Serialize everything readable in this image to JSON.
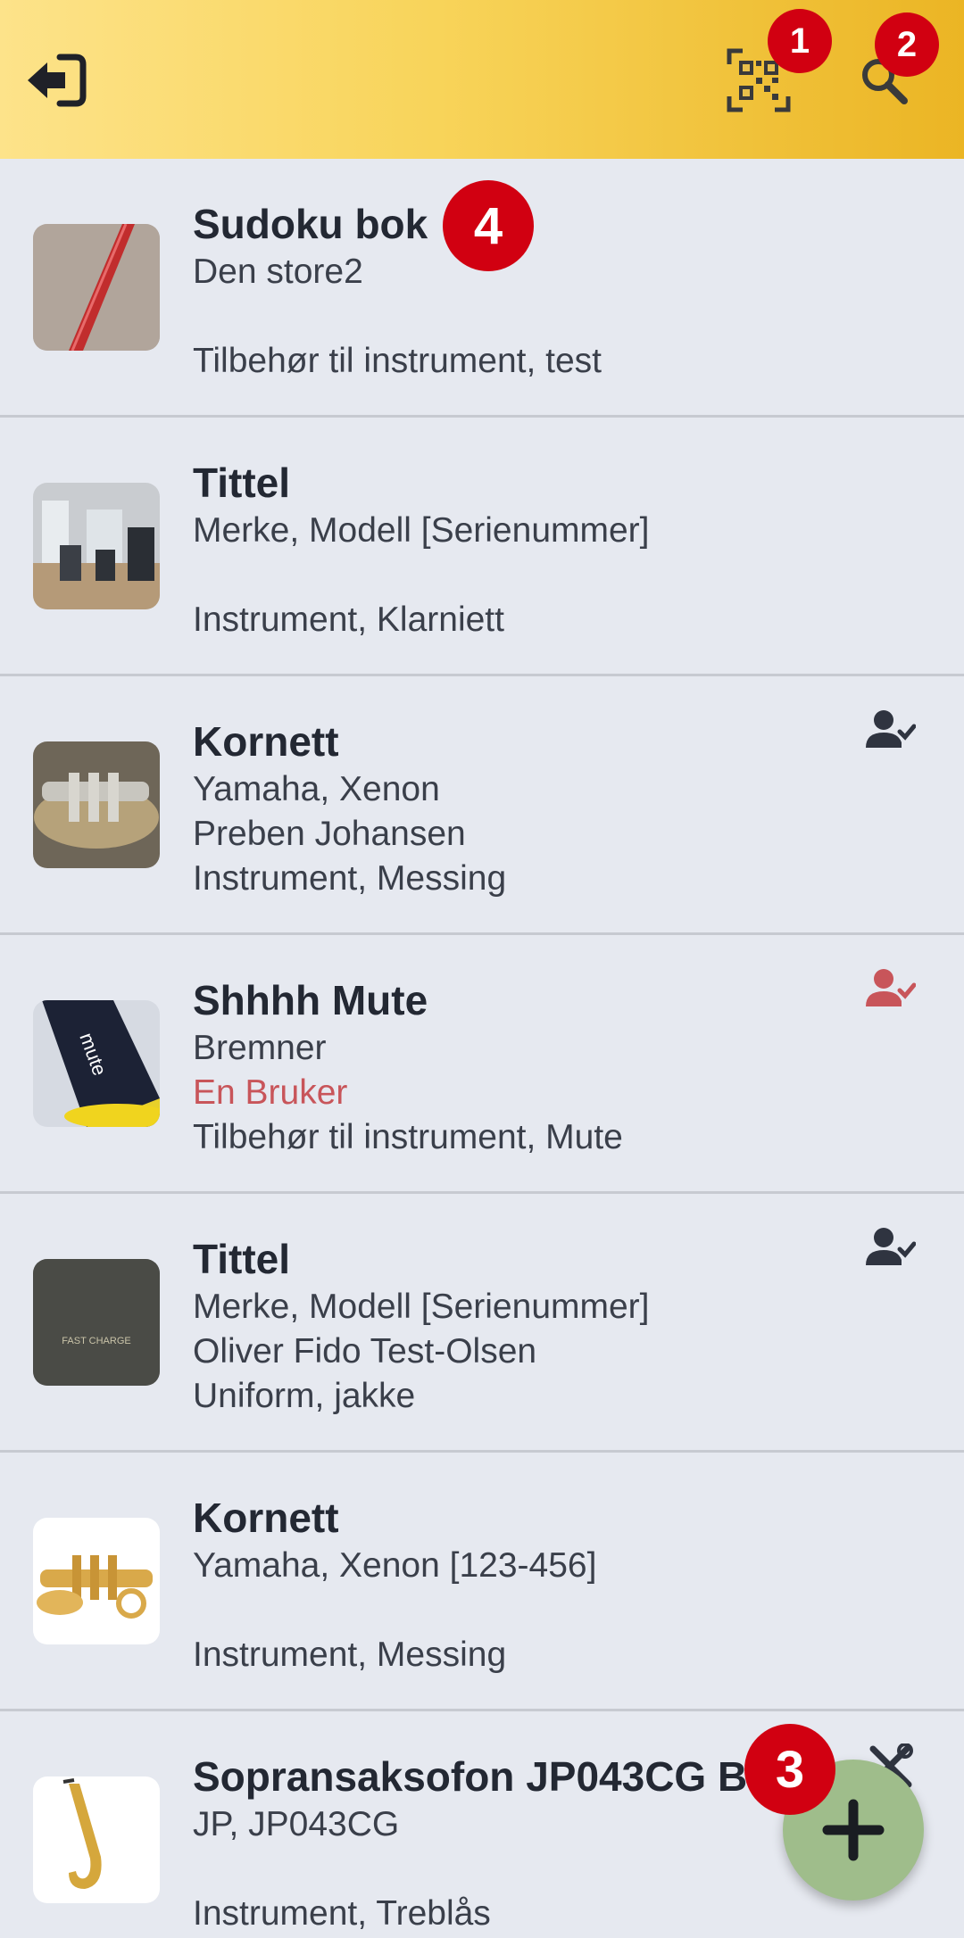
{
  "appbar": {
    "back_icon": "logout-arrow-icon",
    "qr_icon": "qr-code-scan-icon",
    "search_icon": "search-icon",
    "background_gradient": [
      "#fde38a",
      "#ebb524"
    ]
  },
  "badges": {
    "qr": "1",
    "search": "2",
    "fab": "3",
    "first_item": "4",
    "color": "#d10011"
  },
  "items": [
    {
      "title": "Sudoku bok",
      "line1": "Den store2",
      "line2": "",
      "line3": "Tilbehør til instrument, test",
      "status_icon": ""
    },
    {
      "title": "Tittel",
      "line1": "Merke, Modell [Serienummer]",
      "line2": "",
      "line3": "Instrument, Klarniett",
      "status_icon": ""
    },
    {
      "title": "Kornett",
      "line1": "Yamaha, Xenon",
      "line2": "Preben Johansen",
      "line3": "Instrument, Messing",
      "status_icon": "user-check-icon"
    },
    {
      "title": "Shhhh Mute",
      "line1": "Bremner",
      "line2": "En Bruker",
      "line3": "Tilbehør til instrument, Mute",
      "status_icon": "user-check-icon",
      "status_color": "#c8555a"
    },
    {
      "title": "Tittel",
      "line1": "Merke, Modell [Serienummer]",
      "line2": "Oliver Fido Test-Olsen",
      "line3": "Uniform, jakke",
      "status_icon": "user-check-icon"
    },
    {
      "title": "Kornett",
      "line1": "Yamaha, Xenon [123-456]",
      "line2": "",
      "line3": "Instrument, Messing",
      "status_icon": ""
    },
    {
      "title": "Sopransaksofon JP043CG B",
      "line1": "JP, JP043CG",
      "line2": "",
      "line3": "Instrument, Treblås",
      "status_icon": "tools-icon"
    }
  ],
  "fab": {
    "icon": "plus-icon",
    "color": "#9fbd8b"
  }
}
